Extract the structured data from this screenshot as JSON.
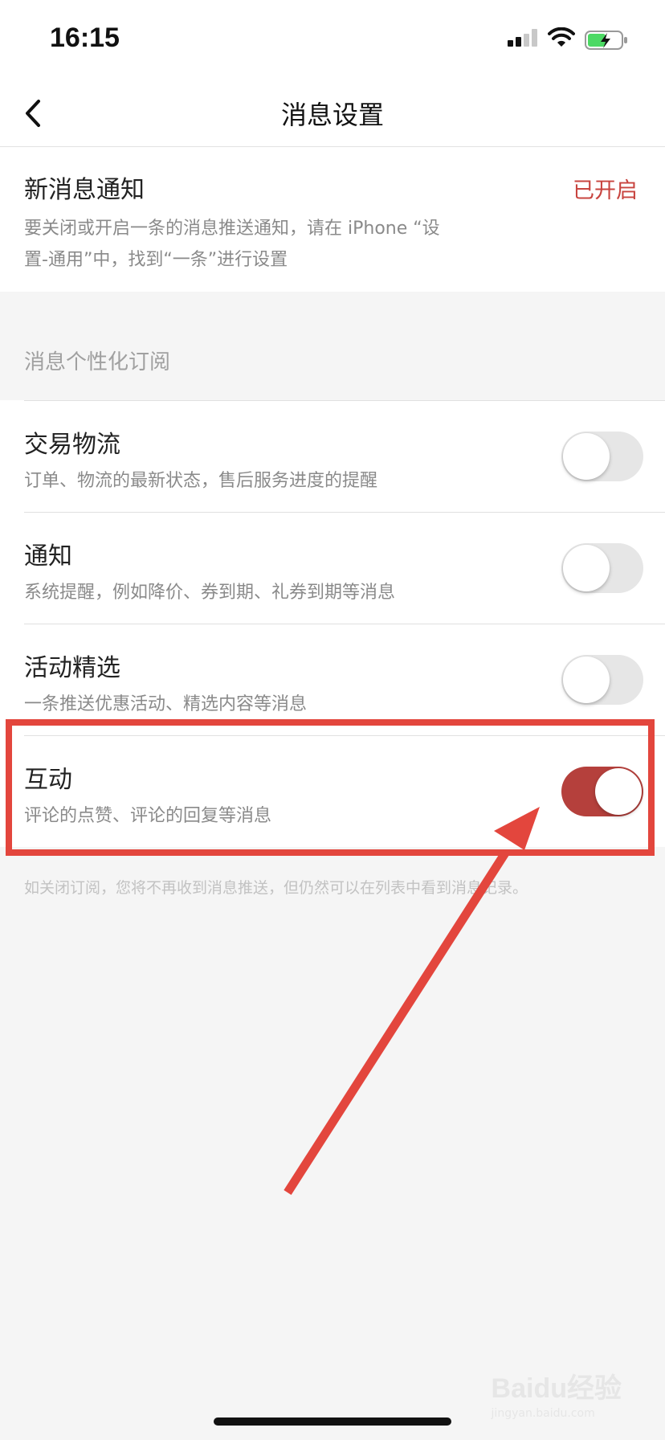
{
  "status_bar": {
    "time": "16:15",
    "icons": [
      "signal-icon",
      "wifi-icon",
      "battery-charging-icon"
    ]
  },
  "nav": {
    "title": "消息设置",
    "back_icon": "chevron-left-icon"
  },
  "new_message": {
    "title": "新消息通知",
    "status": "已开启",
    "desc_line1": "要关闭或开启一条的消息推送通知，请在 iPhone “设",
    "desc_line2": "置-通用”中，找到“一条”进行设置"
  },
  "subscription": {
    "header": "消息个性化订阅",
    "items": [
      {
        "title": "交易物流",
        "desc": "订单、物流的最新状态，售后服务进度的提醒",
        "enabled": false
      },
      {
        "title": "通知",
        "desc": "系统提醒，例如降价、券到期、礼券到期等消息",
        "enabled": false
      },
      {
        "title": "活动精选",
        "desc": "一条推送优惠活动、精选内容等消息",
        "enabled": false
      },
      {
        "title": "互动",
        "desc": "评论的点赞、评论的回复等消息",
        "enabled": true
      }
    ],
    "footer": "如关闭订阅，您将不再收到消息推送，但仍然可以在列表中看到消息记录。"
  },
  "colors": {
    "accent": "#c8443f",
    "toggle_on": "#b5403c",
    "toggle_off": "#e6e6e6",
    "annotation": "#e3463d"
  },
  "watermark": {
    "text": "Baidu经验",
    "sub": "jingyan.baidu.com"
  }
}
